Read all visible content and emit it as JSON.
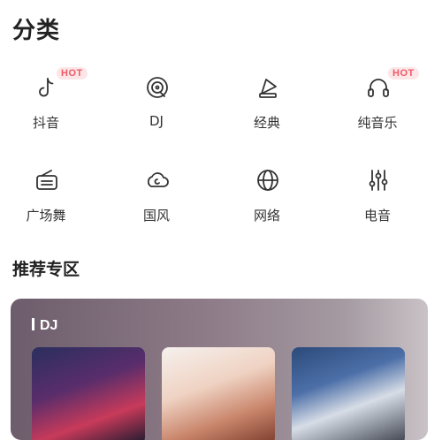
{
  "category_section": {
    "title": "分类"
  },
  "categories": [
    {
      "label": "抖音",
      "icon": "tiktok-icon",
      "badge": "HOT"
    },
    {
      "label": "DJ",
      "icon": "vinyl-disc-icon",
      "badge": ""
    },
    {
      "label": "经典",
      "icon": "gramophone-icon",
      "badge": ""
    },
    {
      "label": "纯音乐",
      "icon": "headphones-icon",
      "badge": "HOT"
    },
    {
      "label": "广场舞",
      "icon": "radio-icon",
      "badge": ""
    },
    {
      "label": "国风",
      "icon": "cloud-swirl-icon",
      "badge": ""
    },
    {
      "label": "网络",
      "icon": "globe-icon",
      "badge": ""
    },
    {
      "label": "电音",
      "icon": "equalizer-icon",
      "badge": ""
    }
  ],
  "recommend_section": {
    "title": "推荐专区",
    "card_title": "DJ",
    "thumbnails": [
      "dj-cover-1",
      "dj-cover-2",
      "dj-cover-3"
    ]
  },
  "colors": {
    "hot_badge_bg": "#fde6e8",
    "hot_badge_text": "#ee5a66"
  }
}
